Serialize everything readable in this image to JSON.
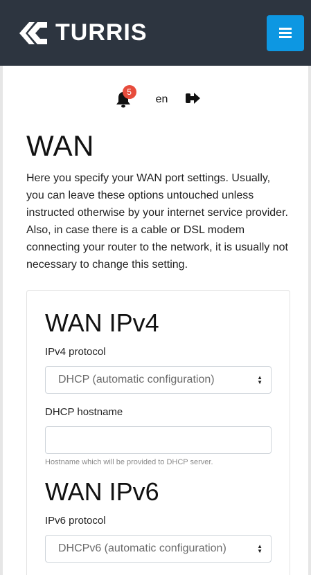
{
  "navbar": {
    "brand": "TURRIS"
  },
  "toolbar": {
    "notifications_count": "5",
    "language": "en"
  },
  "page": {
    "title": "WAN",
    "description": "Here you specify your WAN port settings. Usually, you can leave these options untouched unless instructed otherwise by your internet service provider. Also, in case there is a cable or DSL modem connecting your router to the network, it is usually not necessary to change this setting."
  },
  "ipv4": {
    "heading": "WAN IPv4",
    "protocol_label": "IPv4 protocol",
    "protocol_value": "DHCP (automatic configuration)",
    "hostname_label": "DHCP hostname",
    "hostname_value": "",
    "hostname_help": "Hostname which will be provided to DHCP server."
  },
  "ipv6": {
    "heading": "WAN IPv6",
    "protocol_label": "IPv6 protocol",
    "protocol_value": "DHCPv6 (automatic configuration)"
  },
  "colors": {
    "navbar": "#2d3540",
    "accent": "#0d97e2",
    "badge": "#e74c3c"
  },
  "icons": [
    "turris-logo-icon",
    "hamburger-menu-icon",
    "bell-icon",
    "logout-icon",
    "select-caret-icon"
  ]
}
